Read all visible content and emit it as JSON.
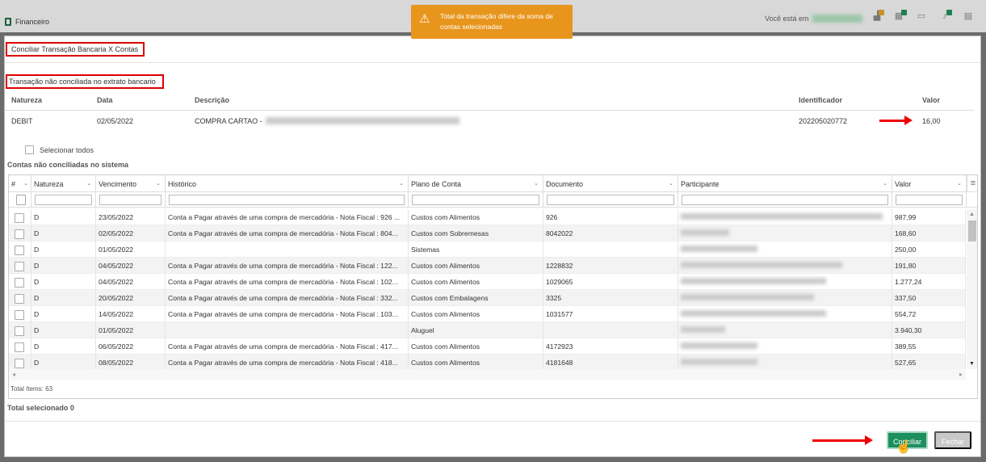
{
  "topbar": {
    "app_title": "Financeiro",
    "you_are_in": "Você está em"
  },
  "toast": {
    "message": "Total da transação difere da soma de contas selecionadas"
  },
  "modal": {
    "title": "Conciliar Transação Bancaria X Contas"
  },
  "bank": {
    "section_title": "Transação não conciliada no extrato bancario",
    "headers": {
      "natureza": "Natureza",
      "data": "Data",
      "descricao": "Descrição",
      "identificador": "Identificador",
      "valor": "Valor"
    },
    "row": {
      "natureza": "DEBIT",
      "data": "02/05/2022",
      "descricao": "COMPRA CARTAO -",
      "identificador": "202205020772",
      "valor": "16,00"
    }
  },
  "select_all_label": "Selecionar todos",
  "accounts_section_title": "Contas não conciliadas no sistema",
  "grid": {
    "headers": {
      "num": "#",
      "natureza": "Natureza",
      "vencimento": "Vencimento",
      "historico": "Histórico",
      "plano": "Plano de Conta",
      "documento": "Documento",
      "participante": "Participante",
      "valor": "Valor"
    },
    "rows": [
      {
        "natureza": "D",
        "vencimento": "23/05/2022",
        "historico": "Conta a Pagar através de uma compra de mercadória - Nota Fiscal : 926 ...",
        "plano": "Custos com Alimentos",
        "documento": "926",
        "valor": "987,99"
      },
      {
        "natureza": "D",
        "vencimento": "02/05/2022",
        "historico": "Conta a Pagar através de uma compra de mercadória - Nota Fiscal : 804...",
        "plano": "Custos com Sobremesas",
        "documento": "8042022",
        "valor": "168,60"
      },
      {
        "natureza": "D",
        "vencimento": "01/05/2022",
        "historico": "",
        "plano": "Sistemas",
        "documento": "",
        "valor": "250,00"
      },
      {
        "natureza": "D",
        "vencimento": "04/05/2022",
        "historico": "Conta a Pagar através de uma compra de mercadória - Nota Fiscal : 122...",
        "plano": "Custos com Alimentos",
        "documento": "1228832",
        "valor": "191,80"
      },
      {
        "natureza": "D",
        "vencimento": "04/05/2022",
        "historico": "Conta a Pagar através de uma compra de mercadória - Nota Fiscal : 102...",
        "plano": "Custos com Alimentos",
        "documento": "1029065",
        "valor": "1.277,24"
      },
      {
        "natureza": "D",
        "vencimento": "20/05/2022",
        "historico": "Conta a Pagar através de uma compra de mercadória - Nota Fiscal : 332...",
        "plano": "Custos com Embalagens",
        "documento": "3325",
        "valor": "337,50"
      },
      {
        "natureza": "D",
        "vencimento": "14/05/2022",
        "historico": "Conta a Pagar através de uma compra de mercadória - Nota Fiscal : 103...",
        "plano": "Custos com Alimentos",
        "documento": "1031577",
        "valor": "554,72"
      },
      {
        "natureza": "D",
        "vencimento": "01/05/2022",
        "historico": "",
        "plano": "Aluguel",
        "documento": "",
        "valor": "3.940,30"
      },
      {
        "natureza": "D",
        "vencimento": "06/05/2022",
        "historico": "Conta a Pagar através de uma compra de mercadória - Nota Fiscal : 417...",
        "plano": "Custos com Alimentos",
        "documento": "4172923",
        "valor": "389,55"
      },
      {
        "natureza": "D",
        "vencimento": "08/05/2022",
        "historico": "Conta a Pagar através de uma compra de mercadória - Nota Fiscal : 418...",
        "plano": "Custos com Alimentos",
        "documento": "4181648",
        "valor": "527,65"
      }
    ],
    "total_items": "Total Items: 63"
  },
  "total_selected": "Total selecionado 0",
  "buttons": {
    "conciliar": "Conciliar",
    "fechar": "Fechar"
  },
  "colors": {
    "accent": "#1e8f5f",
    "toast": "#e8951e",
    "highlight": "#dd0000"
  }
}
